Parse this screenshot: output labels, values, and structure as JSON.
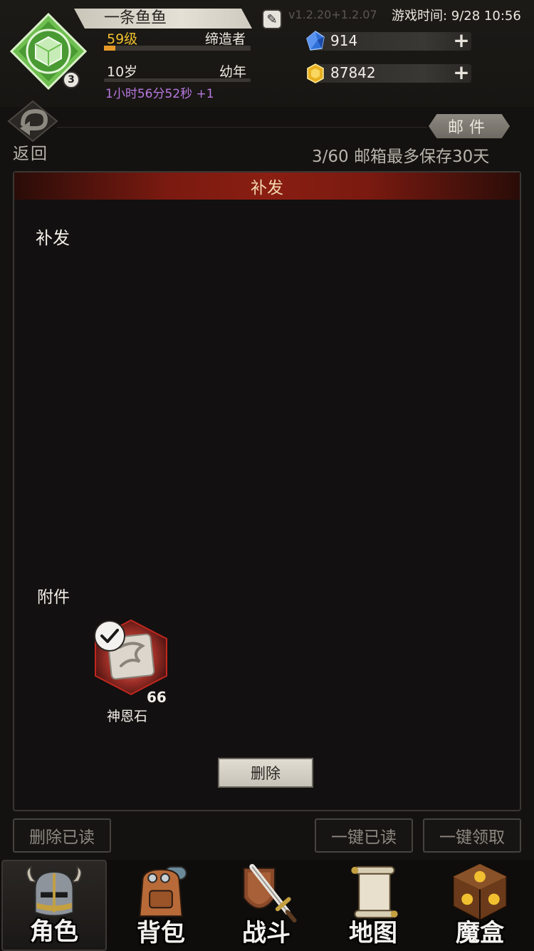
{
  "header": {
    "player_name": "一条鱼鱼",
    "version": "v1.2.20+1.2.07",
    "game_time": "游戏时间: 9/28 10:56",
    "avatar_level": "3",
    "level": "59级",
    "class_title": "缔造者",
    "level_progress": 0.08,
    "age": "10岁",
    "age_stage": "幼年",
    "age_progress": 0.0,
    "timer": "1小时56分52秒 +1",
    "gems": "914",
    "gold": "87842"
  },
  "nav": {
    "back_label": "返回",
    "mail_tab": "邮件",
    "mail_info": "3/60 邮箱最多保存30天"
  },
  "mail": {
    "title": "补发",
    "body": "补发",
    "attachments_label": "附件",
    "attachments": [
      {
        "name": "神恩石",
        "count": "66",
        "claimed": true
      }
    ],
    "delete_label": "删除"
  },
  "actions": {
    "delete_read": "删除已读",
    "mark_all_read": "一键已读",
    "claim_all": "一键领取"
  },
  "bottom_nav": [
    {
      "label": "角色",
      "icon": "helmet-icon",
      "active": true
    },
    {
      "label": "背包",
      "icon": "backpack-icon",
      "active": false
    },
    {
      "label": "战斗",
      "icon": "sword-shield-icon",
      "active": false
    },
    {
      "label": "地图",
      "icon": "scroll-map-icon",
      "active": false
    },
    {
      "label": "魔盒",
      "icon": "magic-box-icon",
      "active": false
    }
  ],
  "colors": {
    "accent_red": "#8a1e12",
    "level_gold": "#f0c030",
    "timer_purple": "#b878e0",
    "background": "#141210"
  }
}
